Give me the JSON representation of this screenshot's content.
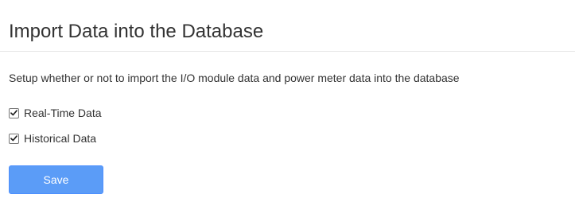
{
  "section": {
    "title": "Import Data into the Database",
    "description": "Setup whether or not to import the I/O module data and power meter data into the database"
  },
  "options": [
    {
      "label": "Real-Time Data",
      "checked": true
    },
    {
      "label": "Historical Data",
      "checked": true
    }
  ],
  "actions": {
    "save_label": "Save"
  },
  "colors": {
    "accent": "#5b9cf7",
    "text": "#333333",
    "divider": "#e5e5e5"
  },
  "icons": {
    "checkbox_checked": "checkmark-icon"
  }
}
